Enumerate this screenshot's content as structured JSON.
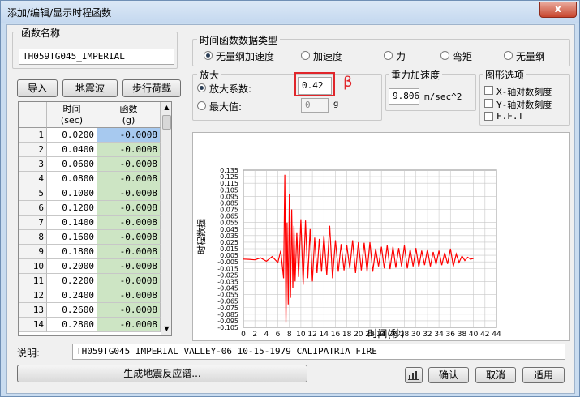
{
  "window": {
    "title": "添加/编辑/显示时程函数",
    "close": "x"
  },
  "func_name": {
    "legend": "函数名称",
    "value": "TH059TG045_IMPERIAL"
  },
  "toolbar": {
    "import": "导入",
    "earthquake": "地震波",
    "step_load": "步行荷载"
  },
  "grid": {
    "col_time": "时间",
    "col_time_unit": "(sec)",
    "col_func": "函数",
    "col_func_unit": "(g)",
    "rows": [
      {
        "n": "1",
        "t": "0.0200",
        "v": "-0.0008"
      },
      {
        "n": "2",
        "t": "0.0400",
        "v": "-0.0008"
      },
      {
        "n": "3",
        "t": "0.0600",
        "v": "-0.0008"
      },
      {
        "n": "4",
        "t": "0.0800",
        "v": "-0.0008"
      },
      {
        "n": "5",
        "t": "0.1000",
        "v": "-0.0008"
      },
      {
        "n": "6",
        "t": "0.1200",
        "v": "-0.0008"
      },
      {
        "n": "7",
        "t": "0.1400",
        "v": "-0.0008"
      },
      {
        "n": "8",
        "t": "0.1600",
        "v": "-0.0008"
      },
      {
        "n": "9",
        "t": "0.1800",
        "v": "-0.0008"
      },
      {
        "n": "10",
        "t": "0.2000",
        "v": "-0.0008"
      },
      {
        "n": "11",
        "t": "0.2200",
        "v": "-0.0008"
      },
      {
        "n": "12",
        "t": "0.2400",
        "v": "-0.0008"
      },
      {
        "n": "13",
        "t": "0.2600",
        "v": "-0.0008"
      },
      {
        "n": "14",
        "t": "0.2800",
        "v": "-0.0008"
      }
    ]
  },
  "data_type": {
    "legend": "时间函数数据类型",
    "options": [
      {
        "label": "无量纲加速度",
        "selected": true
      },
      {
        "label": "加速度",
        "selected": false
      },
      {
        "label": "力",
        "selected": false
      },
      {
        "label": "弯矩",
        "selected": false
      },
      {
        "label": "无量纲",
        "selected": false
      }
    ]
  },
  "scale": {
    "legend": "放大",
    "factor_label": "放大系数:",
    "factor_value": "0.42",
    "factor_selected": true,
    "max_label": "最大值:",
    "max_value": "0",
    "max_unit": "g",
    "annotation": "β"
  },
  "gravity": {
    "legend": "重力加速度",
    "value": "9.806",
    "unit": "m/sec^2"
  },
  "graph_options": {
    "legend": "图形选项",
    "items": [
      {
        "label": "X-轴对数刻度",
        "checked": false
      },
      {
        "label": "Y-轴对数刻度",
        "checked": false
      },
      {
        "label": "F.F.T",
        "checked": false
      }
    ]
  },
  "chart_data": {
    "type": "line",
    "xlabel": "时间(秒)",
    "ylabel": "时程数据",
    "xlim": [
      0,
      44
    ],
    "ylim": [
      -0.105,
      0.135
    ],
    "xticks": [
      0,
      2,
      4,
      6,
      8,
      10,
      12,
      14,
      16,
      18,
      20,
      22,
      24,
      26,
      28,
      30,
      32,
      34,
      36,
      38,
      40,
      42,
      44
    ],
    "yticks": [
      -0.105,
      -0.095,
      -0.085,
      -0.075,
      -0.065,
      -0.055,
      -0.045,
      -0.035,
      -0.025,
      -0.015,
      -0.005,
      0.005,
      0.015,
      0.025,
      0.035,
      0.045,
      0.055,
      0.065,
      0.075,
      0.085,
      0.095,
      0.105,
      0.115,
      0.125,
      0.135
    ],
    "yticklabels": [
      "-0.105",
      "-0.095",
      "-0.085",
      "-0.075",
      "-0.065",
      "-0.055",
      "-0.045",
      "-0.035",
      "-0.025",
      "-0.015",
      "-0.005",
      "0.005",
      "0.015",
      "0.025",
      "0.035",
      "0.045",
      "0.055",
      "0.065",
      "0.075",
      "0.085",
      "0.095",
      "0.105",
      "0.115",
      "0.125",
      "0.135"
    ],
    "grid": true,
    "series_color": "#ff0000",
    "series": [
      {
        "x": [
          0,
          1,
          2,
          3,
          4,
          5,
          6,
          6.5,
          7,
          7.2,
          7.4,
          7.6,
          7.8,
          8,
          8.2,
          8.4,
          8.6,
          8.8,
          9,
          9.3,
          9.6,
          10,
          10.4,
          10.8,
          11.2,
          11.6,
          12,
          12.4,
          12.8,
          13.2,
          13.6,
          14,
          14.5,
          15,
          15.5,
          16,
          16.5,
          17,
          17.5,
          18,
          18.5,
          19,
          19.5,
          20,
          20.5,
          21,
          21.5,
          22,
          22.5,
          23,
          23.5,
          24,
          24.5,
          25,
          25.5,
          26,
          26.5,
          27,
          27.5,
          28,
          28.5,
          29,
          29.5,
          30,
          30.5,
          31,
          31.5,
          32,
          32.5,
          33,
          33.5,
          34,
          34.5,
          35,
          35.5,
          36,
          36.5,
          37,
          37.5,
          38,
          38.5,
          39,
          39.5,
          40
        ],
        "y": [
          -0.0008,
          -0.0012,
          -0.002,
          0.001,
          -0.004,
          0.003,
          -0.006,
          0.012,
          -0.03,
          0.128,
          -0.098,
          0.055,
          -0.07,
          0.098,
          -0.06,
          0.075,
          -0.045,
          0.05,
          -0.035,
          0.04,
          -0.028,
          0.06,
          -0.04,
          0.058,
          -0.03,
          0.045,
          -0.035,
          0.032,
          -0.022,
          0.03,
          -0.02,
          0.035,
          -0.025,
          0.05,
          -0.03,
          0.028,
          -0.02,
          0.022,
          -0.018,
          0.02,
          -0.015,
          0.028,
          -0.022,
          0.025,
          -0.018,
          0.024,
          -0.02,
          0.025,
          -0.02,
          0.015,
          -0.012,
          0.018,
          -0.015,
          0.02,
          -0.016,
          0.018,
          -0.014,
          0.016,
          -0.012,
          0.02,
          -0.015,
          0.014,
          -0.012,
          0.016,
          -0.013,
          0.012,
          -0.01,
          0.014,
          -0.012,
          0.01,
          -0.009,
          0.012,
          -0.01,
          0.009,
          -0.008,
          0.015,
          -0.012,
          0.007,
          -0.006,
          0.004,
          -0.003,
          0.002,
          -0.001,
          0
        ]
      }
    ]
  },
  "description": {
    "label": "说明:",
    "value": "TH059TG045_IMPERIAL VALLEY-06 10-15-1979 CALIPATRIA FIRE"
  },
  "buttons": {
    "spectrum": "生成地震反应谱...",
    "ok": "确认",
    "cancel": "取消",
    "apply": "适用"
  }
}
